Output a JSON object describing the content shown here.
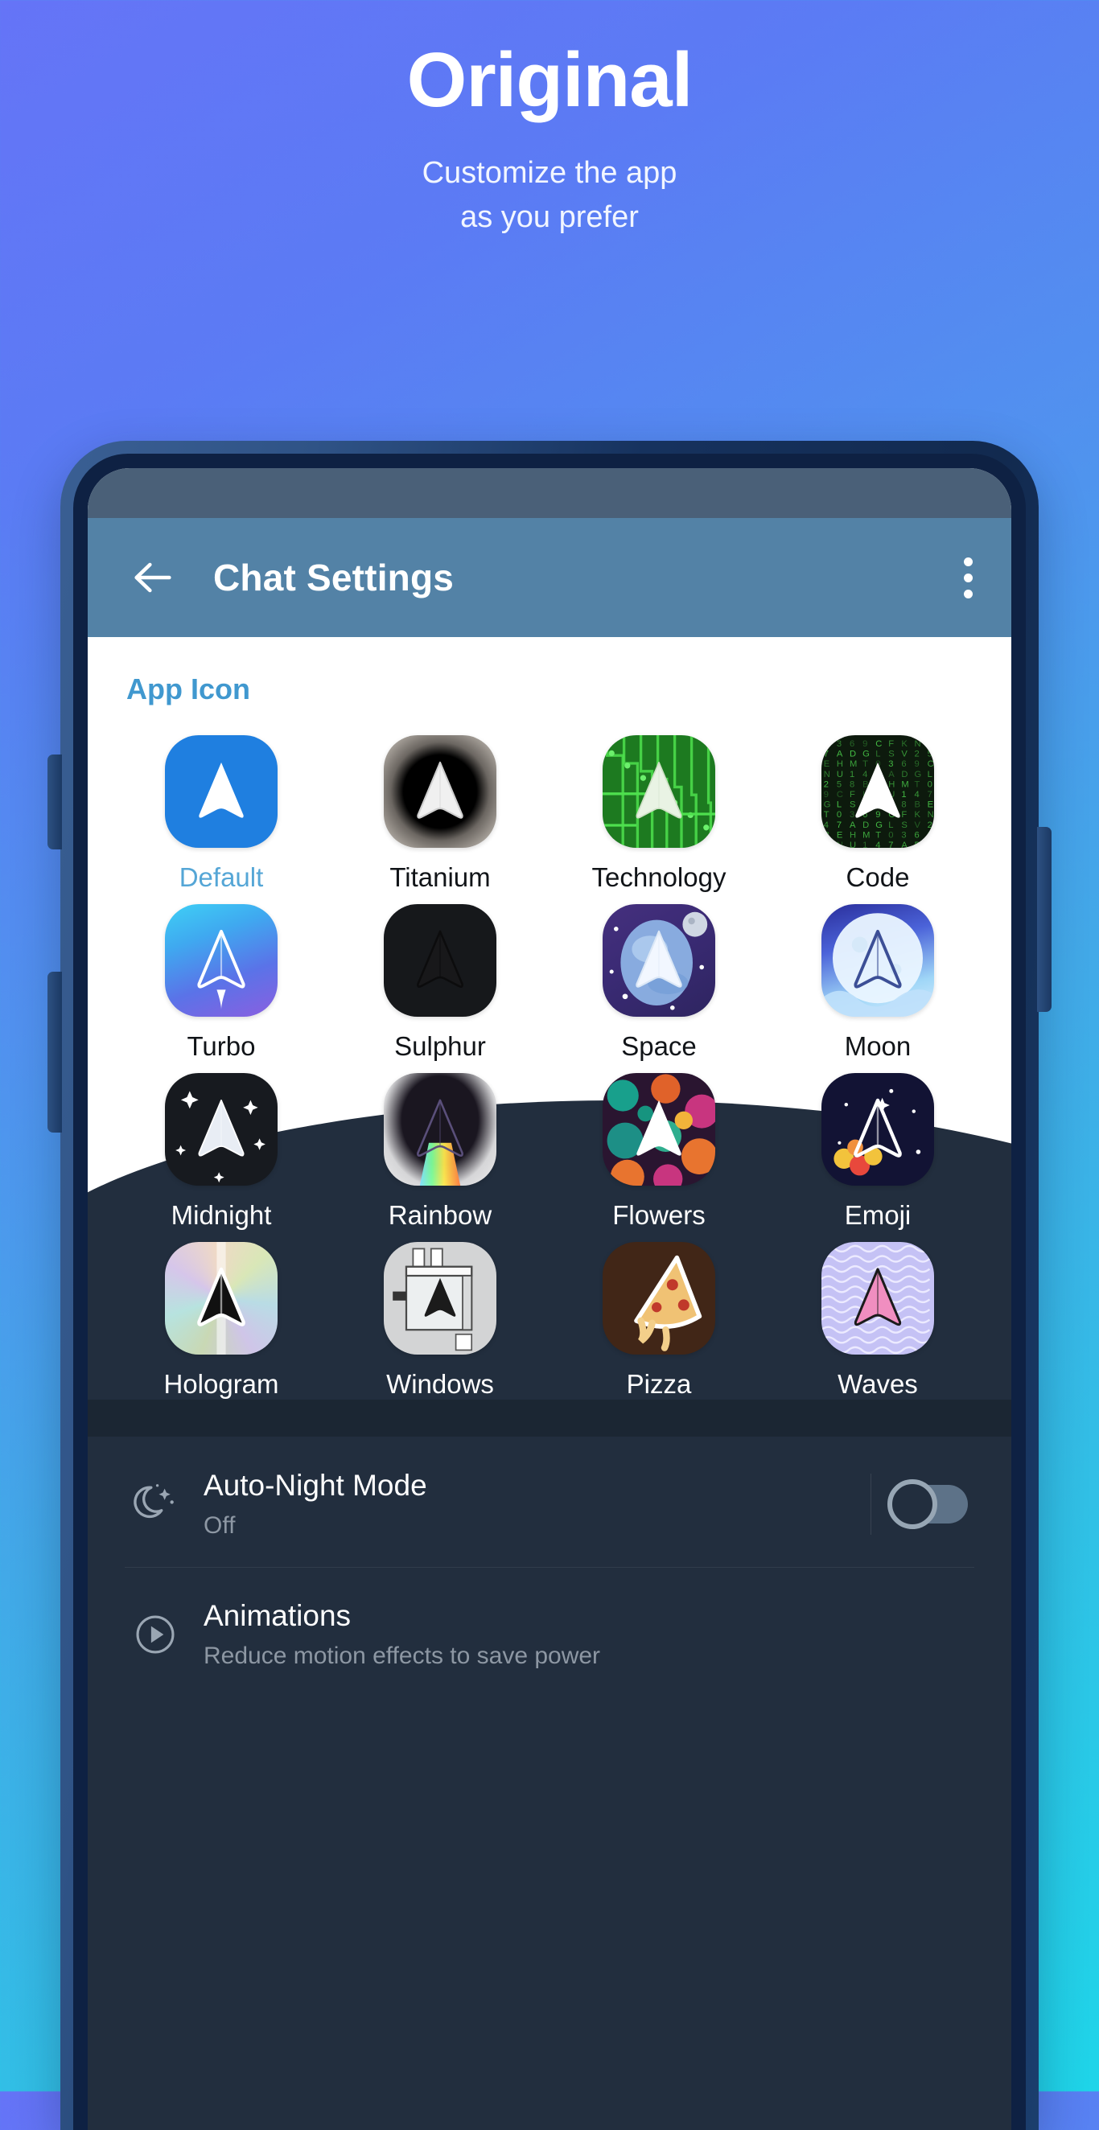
{
  "promo": {
    "title": "Original",
    "subtitle_line1": "Customize the app",
    "subtitle_line2": "as you prefer"
  },
  "appbar": {
    "back_icon": "arrow-left-icon",
    "title": "Chat Settings",
    "menu_icon": "overflow-menu-icon"
  },
  "section": {
    "app_icon_title": "App Icon"
  },
  "icons": [
    {
      "label": "Default",
      "style": "bg-default",
      "selected": true,
      "on_dark": false
    },
    {
      "label": "Titanium",
      "style": "bg-titanium",
      "selected": false,
      "on_dark": false
    },
    {
      "label": "Technology",
      "style": "bg-technology",
      "selected": false,
      "on_dark": false
    },
    {
      "label": "Code",
      "style": "bg-code",
      "selected": false,
      "on_dark": false
    },
    {
      "label": "Turbo",
      "style": "bg-turbo",
      "selected": false,
      "on_dark": false
    },
    {
      "label": "Sulphur",
      "style": "bg-sulphur",
      "selected": false,
      "on_dark": false
    },
    {
      "label": "Space",
      "style": "bg-space",
      "selected": false,
      "on_dark": false
    },
    {
      "label": "Moon",
      "style": "bg-moon",
      "selected": false,
      "on_dark": false
    },
    {
      "label": "Midnight",
      "style": "bg-midnight",
      "selected": false,
      "on_dark": true
    },
    {
      "label": "Rainbow",
      "style": "bg-rainbow",
      "selected": false,
      "on_dark": true
    },
    {
      "label": "Flowers",
      "style": "bg-flowers",
      "selected": false,
      "on_dark": true
    },
    {
      "label": "Emoji",
      "style": "bg-emoji",
      "selected": false,
      "on_dark": true
    },
    {
      "label": "Hologram",
      "style": "bg-hologram",
      "selected": false,
      "on_dark": true
    },
    {
      "label": "Windows",
      "style": "bg-windows",
      "selected": false,
      "on_dark": true
    },
    {
      "label": "Pizza",
      "style": "bg-pizza",
      "selected": false,
      "on_dark": true
    },
    {
      "label": "Waves",
      "style": "bg-waves",
      "selected": false,
      "on_dark": true
    }
  ],
  "settings": [
    {
      "icon": "moon-stars-icon",
      "title": "Auto-Night Mode",
      "subtitle": "Off",
      "control": "toggle",
      "toggle_state": "off"
    },
    {
      "icon": "play-circle-icon",
      "title": "Animations",
      "subtitle": "Reduce motion effects to save power",
      "control": "none",
      "toggle_state": ""
    }
  ],
  "colors": {
    "bg_top": "#6574f7",
    "bg_bottom": "#1fd5e9",
    "appbar": "#5382a6",
    "accent_blue": "#4098cf",
    "dark_panel": "#222e3e",
    "selected_label": "#55a6d6"
  }
}
